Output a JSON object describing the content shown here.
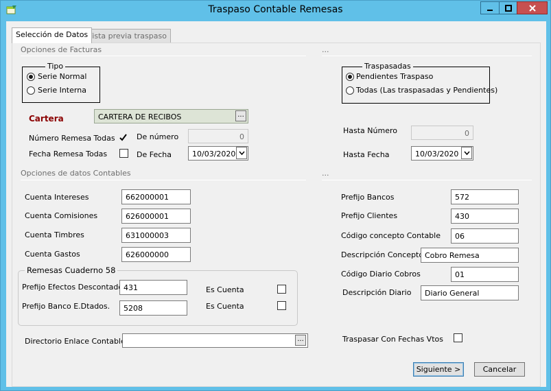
{
  "window": {
    "title": "Traspaso Contable Remesas",
    "icon": "app-form-icon",
    "controls": [
      "minimize-icon",
      "maximize-icon",
      "close-icon"
    ]
  },
  "tabs": [
    {
      "label": "Selección de Datos",
      "active": true
    },
    {
      "label": "Vista previa traspaso",
      "active": false
    }
  ],
  "facturas": {
    "section_label": "Opciones de Facturas",
    "right_section_label": "...",
    "tipo": {
      "title": "Tipo",
      "options": [
        {
          "label": "Serie Normal",
          "selected": true
        },
        {
          "label": "Serie Interna",
          "selected": false
        }
      ]
    },
    "traspasadas": {
      "title": "Traspasadas",
      "options": [
        {
          "label": "Pendientes Traspaso",
          "selected": true
        },
        {
          "label": "Todas (Las traspasadas y Pendientes)",
          "selected": false
        }
      ]
    },
    "cartera": {
      "label": "Cartera",
      "value": "CARTERA DE RECIBOS",
      "button": "..."
    },
    "numero_remesa_todas": {
      "label": "Número Remesa Todas",
      "checked": true
    },
    "fecha_remesa_todas": {
      "label": "Fecha Remesa Todas",
      "checked": false
    },
    "de_numero": {
      "label": "De número",
      "value": "0"
    },
    "de_fecha": {
      "label": "De Fecha",
      "value": "10/03/2020"
    },
    "hasta_numero": {
      "label": "Hasta Número",
      "value": "0"
    },
    "hasta_fecha": {
      "label": "Hasta Fecha",
      "value": "10/03/2020"
    }
  },
  "contables": {
    "section_label": "Opciones de datos Contables",
    "right_section_label": "...",
    "cuenta_intereses": {
      "label": "Cuenta Intereses",
      "value": "662000001"
    },
    "cuenta_comisiones": {
      "label": "Cuenta Comisiones",
      "value": "626000001"
    },
    "cuenta_timbres": {
      "label": "Cuenta Timbres",
      "value": "631000003"
    },
    "cuenta_gastos": {
      "label": "Cuenta Gastos",
      "value": "626000000"
    },
    "prefijo_bancos": {
      "label": "Prefijo Bancos",
      "value": "572"
    },
    "prefijo_clientes": {
      "label": "Prefijo Clientes",
      "value": "430"
    },
    "codigo_concepto": {
      "label": "Código concepto Contable",
      "value": "06"
    },
    "descripcion_concepto": {
      "label": "Descripción Concepto",
      "value": "Cobro Remesa"
    },
    "codigo_diario": {
      "label": "Código Diario Cobros",
      "value": "01"
    },
    "descripcion_diario": {
      "label": "Descripción Diario",
      "value": "Diario General"
    }
  },
  "cuaderno58": {
    "title": "Remesas Cuaderno 58",
    "prefijo_efectos": {
      "label": "Prefijo Efectos Descontados",
      "value": "431"
    },
    "prefijo_banco": {
      "label": "Prefijo Banco E.Dtados.",
      "value": "5208"
    },
    "es_cuenta_1": {
      "label": "Es Cuenta",
      "checked": false
    },
    "es_cuenta_2": {
      "label": "Es Cuenta",
      "checked": false
    }
  },
  "directorio": {
    "label": "Directorio Enlace Contable",
    "value": "",
    "button": "..."
  },
  "fechas_vtos": {
    "label": "Traspasar Con Fechas Vtos",
    "checked": false
  },
  "buttons": {
    "siguiente": "Siguiente >",
    "cancelar": "Cancelar"
  }
}
